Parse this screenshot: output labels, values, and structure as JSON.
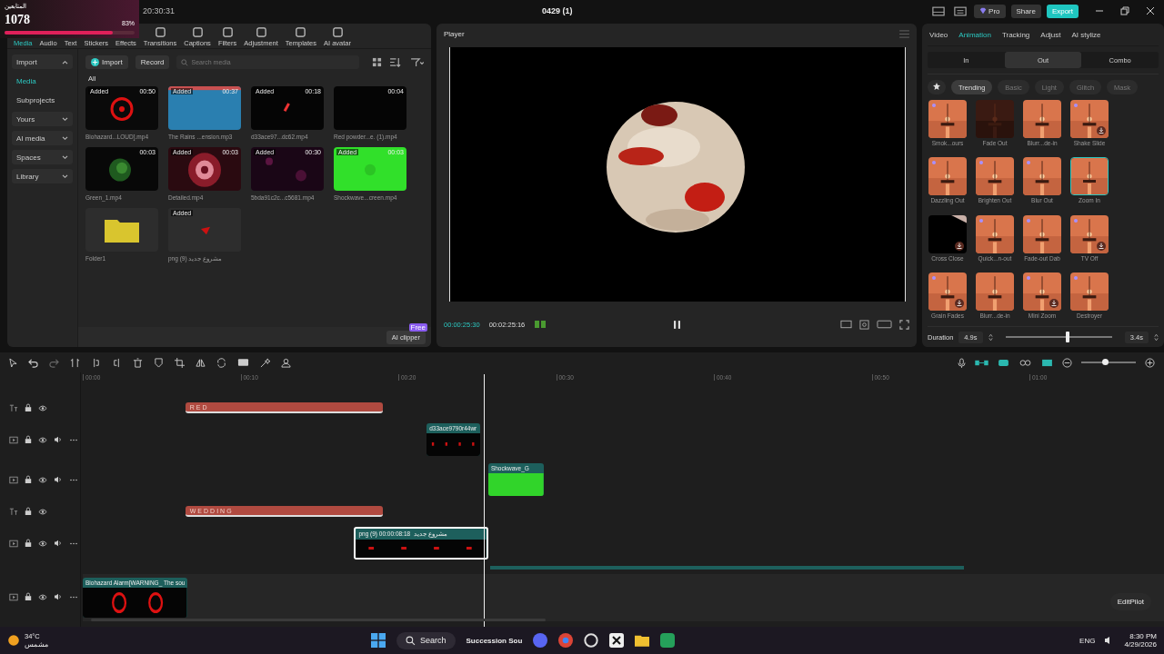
{
  "overlay": {
    "label": "المتابعين",
    "count": "1078",
    "percent": "83%",
    "level": 0.83
  },
  "titlebar": {
    "time": "20:30:31",
    "project": "0429 (1)",
    "pro": "Pro",
    "share": "Share",
    "export": "Export"
  },
  "media_tabs": [
    {
      "label": "Media",
      "selected": true
    },
    {
      "label": "Audio",
      "selected": false
    },
    {
      "label": "Text",
      "selected": false
    },
    {
      "label": "Stickers",
      "selected": false
    },
    {
      "label": "Effects",
      "selected": false
    },
    {
      "label": "Transitions",
      "selected": false
    },
    {
      "label": "Captions",
      "selected": false
    },
    {
      "label": "Filters",
      "selected": false
    },
    {
      "label": "Adjustment",
      "selected": false
    },
    {
      "label": "Templates",
      "selected": false
    },
    {
      "label": "AI avatar",
      "selected": false
    }
  ],
  "sidebar": [
    {
      "label": "Import",
      "kind": "group",
      "expanded": true,
      "selected": false
    },
    {
      "label": "Media",
      "kind": "item",
      "selected": true
    },
    {
      "label": "Subprojects",
      "kind": "item",
      "selected": false
    },
    {
      "label": "Yours",
      "kind": "group",
      "expanded": false,
      "selected": false
    },
    {
      "label": "AI media",
      "kind": "group",
      "expanded": false,
      "selected": false
    },
    {
      "label": "Spaces",
      "kind": "group",
      "expanded": false,
      "selected": false
    },
    {
      "label": "Library",
      "kind": "group",
      "expanded": false,
      "selected": false
    }
  ],
  "media_toolbar": {
    "import": "Import",
    "record": "Record",
    "placeholder": "Search media",
    "filter": "All"
  },
  "media": [
    {
      "name": "Biohazard...LOUD].mp4",
      "duration": "00:50",
      "badge": "Added",
      "kind": "picture"
    },
    {
      "name": "The Rains ...ension.mp3",
      "duration": "00:37",
      "badge": "Added",
      "kind": "picture"
    },
    {
      "name": "d33ace97...dc62.mp4",
      "duration": "00:18",
      "badge": "Added",
      "kind": "picture"
    },
    {
      "name": "Red powder...e. (1).mp4",
      "duration": "00:04",
      "kind": "picture"
    },
    {
      "name": "Green_1.mp4",
      "duration": "00:03",
      "kind": "picture"
    },
    {
      "name": "Detailed.mp4",
      "duration": "00:03",
      "badge": "Added",
      "kind": "picture"
    },
    {
      "name": "5bda91c2c...c5681.mp4",
      "duration": "00:30",
      "badge": "Added",
      "kind": "picture"
    },
    {
      "name": "Shockwave...creen.mp4",
      "duration": "00:03",
      "badge": "Added",
      "kind": "picture"
    },
    {
      "name": "Folder1",
      "kind": "folder"
    },
    {
      "name": "png (9) مشروع جديد",
      "badge": "Added",
      "kind": "picture"
    }
  ],
  "ai_clipper": {
    "label": "AI clipper",
    "badge": "Free"
  },
  "player": {
    "title": "Player",
    "current": "00:00:25:30",
    "total": "00:02:25:16"
  },
  "inspector": {
    "tabs": [
      {
        "label": "Video",
        "selected": false
      },
      {
        "label": "Animation",
        "selected": true
      },
      {
        "label": "Tracking",
        "selected": false
      },
      {
        "label": "Adjust",
        "selected": false
      },
      {
        "label": "AI stylize",
        "selected": false
      }
    ],
    "subtabs": [
      {
        "label": "In",
        "selected": false
      },
      {
        "label": "Out",
        "selected": true
      },
      {
        "label": "Combo",
        "selected": false
      }
    ],
    "categories": [
      {
        "label": "Trending",
        "selected": true
      },
      {
        "label": "Basic",
        "selected": false
      },
      {
        "label": "Light",
        "selected": false
      },
      {
        "label": "Glitch",
        "selected": false
      },
      {
        "label": "Mask",
        "selected": false
      }
    ],
    "animations": [
      {
        "name": "Smok...ours",
        "pro": true,
        "download": false,
        "selected": false
      },
      {
        "name": "Fade Out",
        "pro": false,
        "download": false,
        "selected": false
      },
      {
        "name": "Blurr...de-in",
        "pro": false,
        "download": false,
        "selected": false
      },
      {
        "name": "Shake Slide",
        "pro": true,
        "download": true,
        "selected": false
      },
      {
        "name": "Dazzling Out",
        "pro": true,
        "download": false,
        "selected": false
      },
      {
        "name": "Brighten Out",
        "pro": true,
        "download": false,
        "selected": false
      },
      {
        "name": "Blur Out",
        "pro": true,
        "download": false,
        "selected": false
      },
      {
        "name": "Zoom In",
        "pro": false,
        "download": false,
        "selected": true
      },
      {
        "name": "Cross Close",
        "pro": false,
        "download": true,
        "selected": false
      },
      {
        "name": "Quick...n-out",
        "pro": true,
        "download": false,
        "selected": false
      },
      {
        "name": "Fade-out Dab",
        "pro": true,
        "download": false,
        "selected": false
      },
      {
        "name": "TV Off",
        "pro": true,
        "download": true,
        "selected": false
      },
      {
        "name": "Grain Fades",
        "pro": true,
        "download": true,
        "selected": false
      },
      {
        "name": "Blurr...de-in",
        "pro": false,
        "download": false,
        "selected": false
      },
      {
        "name": "Mini Zoom",
        "pro": true,
        "download": true,
        "selected": false
      },
      {
        "name": "Destroyer",
        "pro": true,
        "download": false,
        "selected": false
      }
    ],
    "duration": {
      "label": "Duration",
      "start": "4.9s",
      "end": "3.4s",
      "level": 0.58
    }
  },
  "timeline": {
    "zoom": {
      "level": 0.45
    },
    "ticks": [
      "00:00",
      "00:10",
      "00:20",
      "00:30",
      "00:40",
      "00:50",
      "01:00"
    ],
    "tracks": [
      {
        "kind": "text",
        "clips": [
          {
            "kind": "text",
            "label": "RED",
            "selected": false
          }
        ]
      },
      {
        "kind": "video",
        "clips": [
          {
            "kind": "video",
            "label": "d33ace9790r44wr",
            "selected": false
          }
        ]
      },
      {
        "kind": "video",
        "clips": [
          {
            "kind": "green",
            "label": "Shockwave_G",
            "selected": false
          }
        ]
      },
      {
        "kind": "text",
        "clips": [
          {
            "kind": "text",
            "label": "WEDDING",
            "selected": false
          }
        ]
      },
      {
        "kind": "video",
        "clips": [
          {
            "kind": "png",
            "label": "png (9) مشروع جديد",
            "time": "00:00:08:18",
            "selected": true
          }
        ]
      },
      {
        "kind": "main",
        "clips": [
          {
            "kind": "bio",
            "label": "Biohazard Alarm[WARNING_ The sou",
            "selected": false
          }
        ]
      }
    ]
  },
  "assistant": {
    "label": "EditPilot"
  },
  "taskbar": {
    "temp": "34°C",
    "weather": "مشمس",
    "search": "Search",
    "app": "Succession Sou",
    "lang": "ENG",
    "time": "8:30 PM",
    "date": "4/29/2026"
  }
}
